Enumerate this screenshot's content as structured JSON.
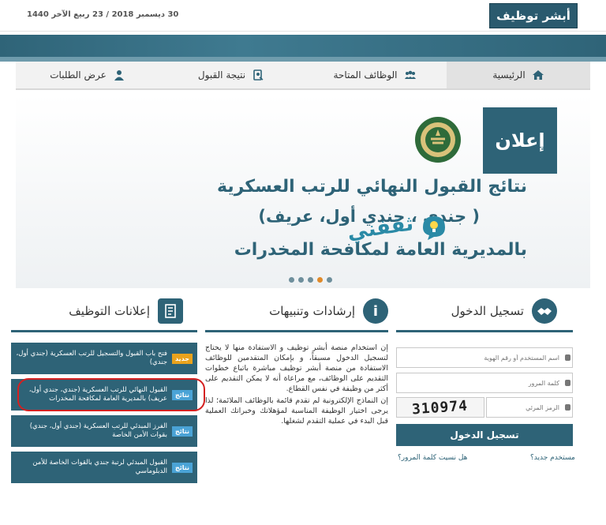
{
  "header": {
    "logo": "أبشر توظيف",
    "date": "30 ديسمبر 2018 / 23 ربيع الآخر 1440"
  },
  "nav": [
    {
      "label": "الرئيسية",
      "icon": "home-icon"
    },
    {
      "label": "الوظائف المتاحة",
      "icon": "users-icon"
    },
    {
      "label": "نتيجة القبول",
      "icon": "result-icon"
    },
    {
      "label": "عرض الطلبات",
      "icon": "user-icon"
    }
  ],
  "hero": {
    "announce_label": "إعلان",
    "line1": "نتائج القبول النهائي للرتب العسكرية",
    "line2": "( جندي ، جندي أول، عريف)",
    "line3": "بالمديرية العامة لمكافحة المخدرات",
    "watermark": "ثقفني",
    "slides": 5,
    "active_slide": 4
  },
  "login": {
    "title": "تسجيل الدخول",
    "username_placeholder": "اسم المستخدم أو رقم الهوية",
    "password_placeholder": "كلمة المرور",
    "captcha_placeholder": "الرمز المرئي",
    "captcha_value": "310974",
    "submit_label": "تسجيل الدخول",
    "new_user_link": "مستخدم جديد؟",
    "forgot_link": "هل نسيت كلمة المرور؟"
  },
  "instructions": {
    "title": "إرشادات وتنبيهات",
    "icon_glyph": "i",
    "paragraphs": [
      "إن استخدام منصة أبشر توظيف و الاستفادة منها لا يحتاج لتسجيل الدخول مسبقاً، و بإمكان المتقدمين للوظائف الاستفادة من منصة أبشر توظيف مباشرة باتباع خطوات التقديم على الوظائف، مع مراعاة أنه لا يمكن التقديم على أكثر من وظيفة في نفس القطاع.",
      "إن النماذج الإلكترونية لم تقدم قائمة بالوظائف الملائمة؛ لذا يرجى اختيار الوظيفة المناسبة لمؤهلاتك وخبراتك العملية قبل البدء في عملية التقدم لشغلها."
    ]
  },
  "jobs": {
    "title": "إعلانات التوظيف",
    "items": [
      {
        "badge": "جديد",
        "type": "new",
        "text": "فتح باب القبول والتسجيل للرتب العسكرية (جندي أول، جندي)"
      },
      {
        "badge": "نتائج",
        "type": "result",
        "text": "القبول النهائي للرتب العسكرية (جندي، جندي أول، عريف) بالمديرية العامة لمكافحة المخدرات"
      },
      {
        "badge": "نتائج",
        "type": "result",
        "text": "الفرز المبدئي للرتب العسكرية (جندي أول، جندي) بقوات الأمن الخاصة"
      },
      {
        "badge": "نتائج",
        "type": "result",
        "text": "القبول المبدئي لرتبة جندي بالقوات الخاصة للأمن الدبلوماسي"
      }
    ]
  },
  "colors": {
    "primary": "#2e6377",
    "badge_new": "#e9a21c",
    "badge_result": "#4aa3d6",
    "highlight_ring": "#d42020"
  }
}
